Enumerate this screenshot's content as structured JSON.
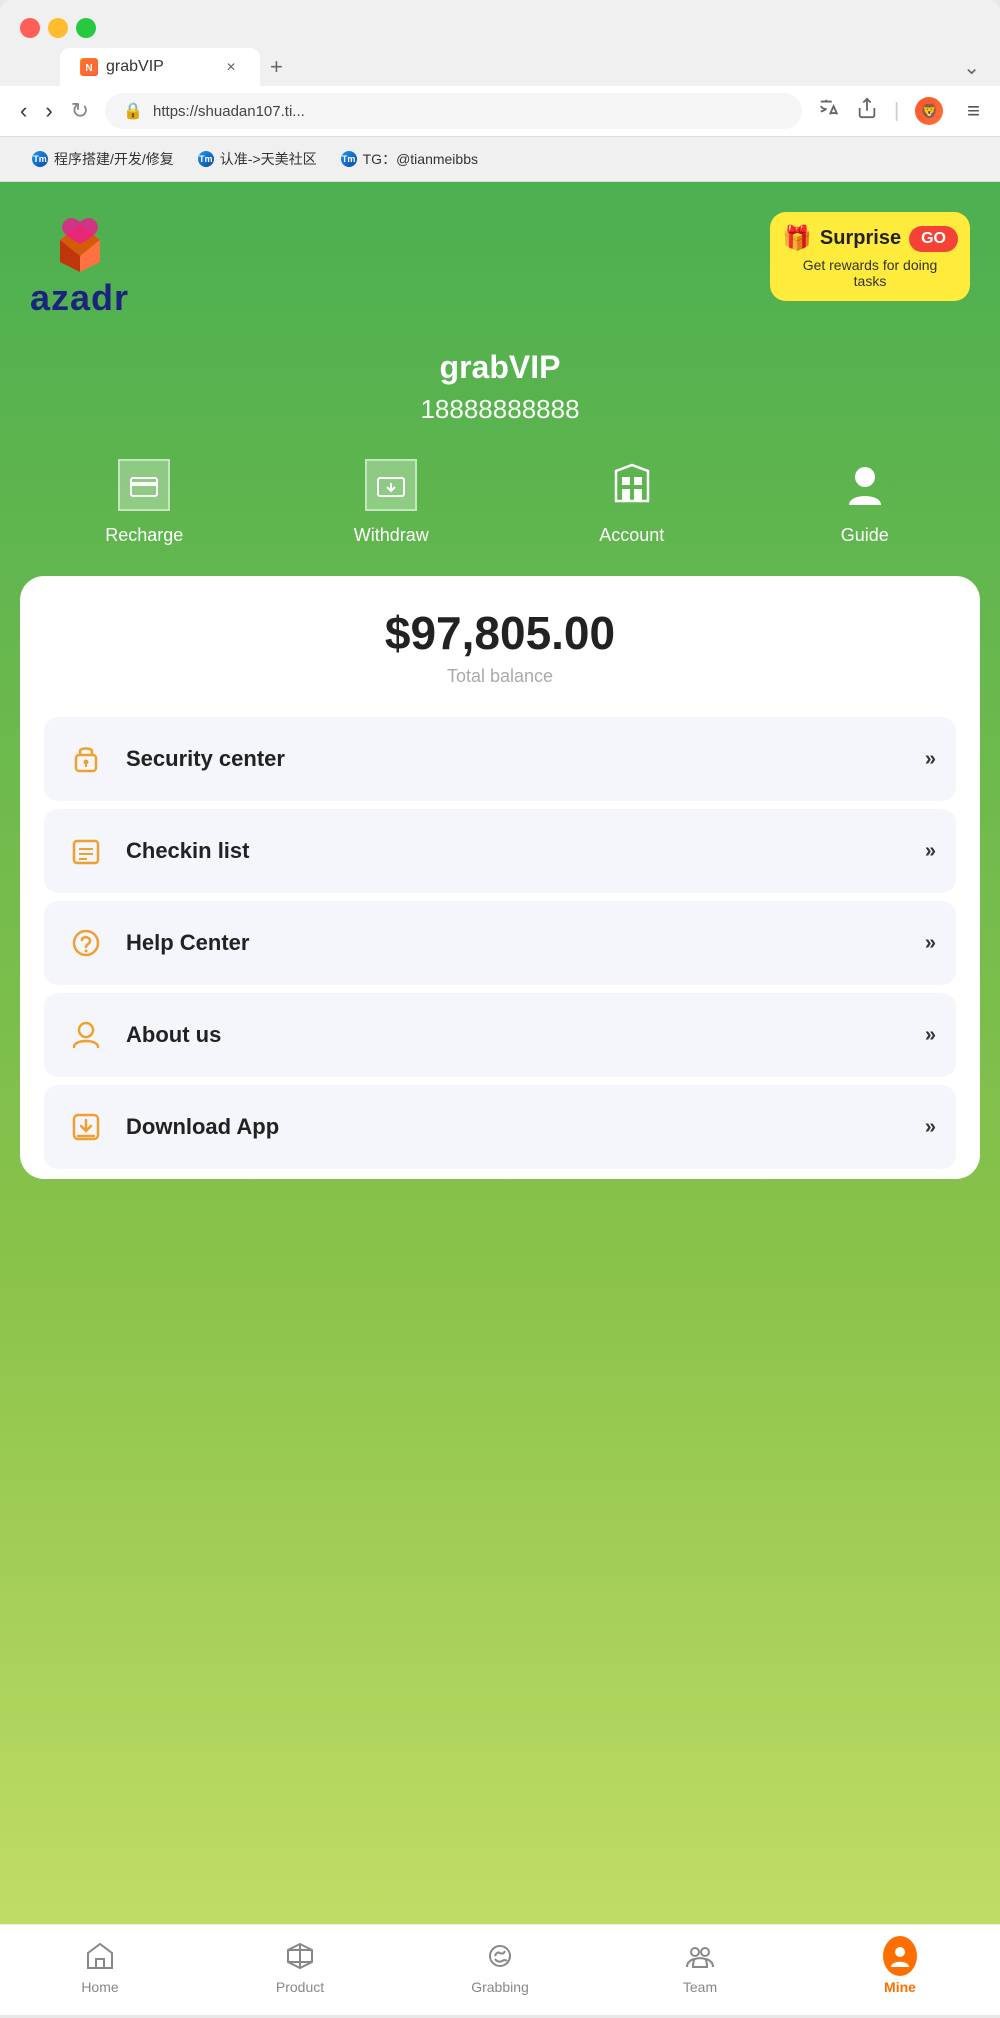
{
  "browser": {
    "tab_title": "grabVIP",
    "tab_favicon": "N",
    "url": "https://shuadan107.ti...",
    "bookmarks": [
      {
        "favicon_text": "Tm",
        "label": "程序搭建/开发/修复"
      },
      {
        "favicon_text": "Tm",
        "label": "认准->天美社区"
      },
      {
        "favicon_text": "Tm",
        "label": "TG：@tianmeibbs"
      }
    ]
  },
  "app": {
    "logo_text": "azadr",
    "surprise": {
      "title": "Surprise",
      "go_label": "GO",
      "subtitle": "Get rewards for doing tasks"
    },
    "username": "grabVIP",
    "phone": "18888888888",
    "quick_actions": [
      {
        "label": "Recharge",
        "icon": "recharge"
      },
      {
        "label": "Withdraw",
        "icon": "withdraw"
      },
      {
        "label": "Account",
        "icon": "account"
      },
      {
        "label": "Guide",
        "icon": "guide"
      }
    ],
    "balance": {
      "amount": "$97,805.00",
      "label": "Total balance"
    },
    "menu_items": [
      {
        "icon": "🔒",
        "label": "Security center",
        "color": "#f0a030"
      },
      {
        "icon": "📋",
        "label": "Checkin list",
        "color": "#f0a030"
      },
      {
        "icon": "🤝",
        "label": "Help Center",
        "color": "#f0a030"
      },
      {
        "icon": "👤",
        "label": "About us",
        "color": "#f0a030"
      },
      {
        "icon": "📥",
        "label": "Download App",
        "color": "#f0a030"
      }
    ],
    "bottom_nav": [
      {
        "label": "Home",
        "icon": "home",
        "active": false
      },
      {
        "label": "Product",
        "icon": "product",
        "active": false
      },
      {
        "label": "Grabbing",
        "icon": "grabbing",
        "active": false
      },
      {
        "label": "Team",
        "icon": "team",
        "active": false
      },
      {
        "label": "Mine",
        "icon": "mine",
        "active": true
      }
    ]
  }
}
